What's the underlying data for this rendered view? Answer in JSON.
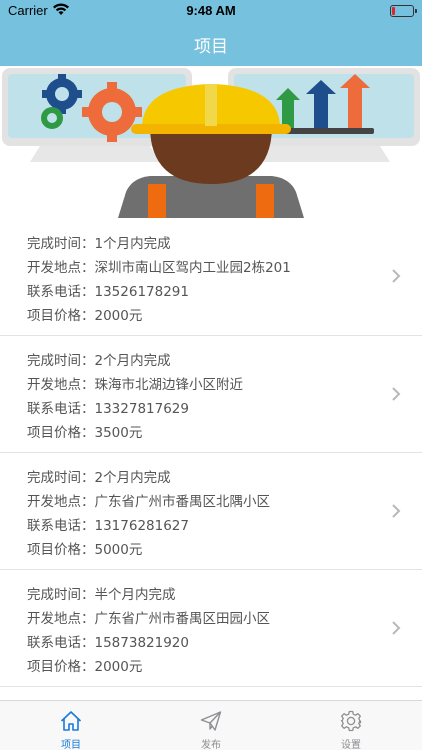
{
  "status_bar": {
    "carrier": "Carrier",
    "time": "9:48 AM",
    "battery_color": "#e0262b"
  },
  "nav": {
    "title": "项目",
    "background": "#76c2de"
  },
  "projects": [
    {
      "time_label": "完成时间：",
      "time_value": "1个月内完成",
      "location_label": "开发地点：",
      "location_value": "深圳市南山区驾内工业园2栋201",
      "phone_label": "联系电话：",
      "phone_value": "13526178291",
      "price_label": "项目价格：",
      "price_value": "2000元"
    },
    {
      "time_label": "完成时间：",
      "time_value": "2个月内完成",
      "location_label": "开发地点：",
      "location_value": "珠海市北湖边锋小区附近",
      "phone_label": "联系电话：",
      "phone_value": "13327817629",
      "price_label": "项目价格：",
      "price_value": "3500元"
    },
    {
      "time_label": "完成时间：",
      "time_value": "2个月内完成",
      "location_label": "开发地点：",
      "location_value": "广东省广州市番禺区北隅小区",
      "phone_label": "联系电话：",
      "phone_value": "13176281627",
      "price_label": "项目价格：",
      "price_value": "5000元"
    },
    {
      "time_label": "完成时间：",
      "time_value": "半个月内完成",
      "location_label": "开发地点：",
      "location_value": "广东省广州市番禺区田园小区",
      "phone_label": "联系电话：",
      "phone_value": "15873821920",
      "price_label": "项目价格：",
      "price_value": "2000元"
    }
  ],
  "tabbar": {
    "tabs": [
      {
        "label": "项目",
        "icon": "home-icon",
        "active": true
      },
      {
        "label": "发布",
        "icon": "paper-plane-icon",
        "active": false
      },
      {
        "label": "设置",
        "icon": "gear-icon",
        "active": false
      }
    ],
    "active_color": "#1a7ad9",
    "inactive_color": "#8e8e93"
  }
}
